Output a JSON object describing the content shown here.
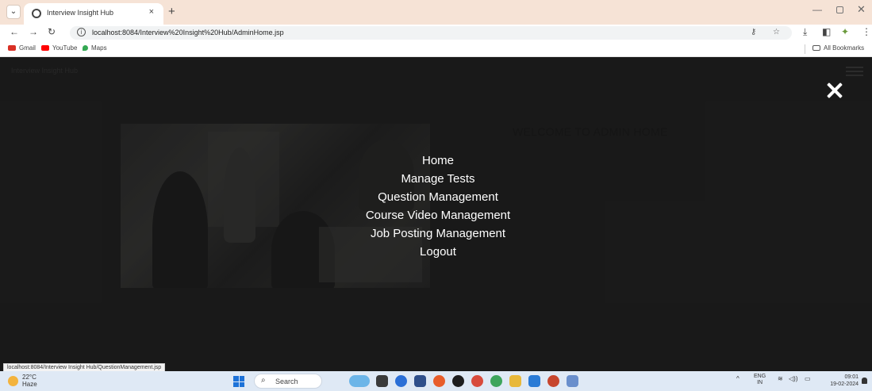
{
  "browser": {
    "tab_title": "Interview Insight Hub",
    "tab_close": "×",
    "new_tab": "+",
    "url": "localhost:8084/Interview%20Insight%20Hub/AdminHome.jsp",
    "window_controls": {
      "minimize": "—",
      "close": "✕"
    },
    "bookmarks": [
      {
        "label": "Gmail",
        "color": "#d93025"
      },
      {
        "label": "YouTube",
        "color": "#ff0000"
      },
      {
        "label": "Maps",
        "color": "#34a853"
      }
    ],
    "all_bookmarks": "All Bookmarks",
    "status_url": "localhost:8084/Interview Insight Hub/QuestionManagement.jsp"
  },
  "page": {
    "brand": "Interview Insight Hub",
    "welcome": "WELCOME TO ADMIN HOME",
    "menu": [
      "Home",
      "Manage Tests",
      "Question Management",
      "Course Video Management",
      "Job Posting Management",
      "Logout"
    ]
  },
  "taskbar": {
    "weather_temp": "22°C",
    "weather_desc": "Haze",
    "search_label": "Search",
    "lang_1": "ENG",
    "lang_2": "IN",
    "time": "09:01",
    "date": "19-02-2024",
    "app_colors": [
      "#6cb5e8",
      "#3a3a3a",
      "#2b6fd6",
      "#2f4f8a",
      "#e85d2a",
      "#1e1e1e",
      "#d84b3c",
      "#3ea55c",
      "#e8b83a",
      "#2a7bd6",
      "#c7462e",
      "#6a8fcc"
    ]
  }
}
